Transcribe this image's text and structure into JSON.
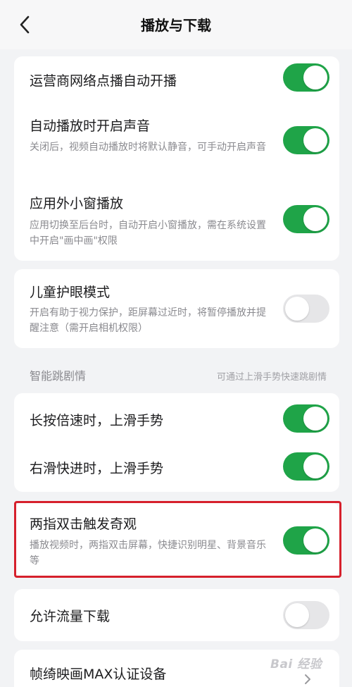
{
  "header": {
    "title": "播放与下载",
    "back_icon": "chevron-left-icon"
  },
  "group1": [
    {
      "title": "运营商网络点播自动开播",
      "desc": "",
      "toggle": "on"
    },
    {
      "title": "自动播放时开启声音",
      "desc": "关闭后，视频自动播放时将默认静音，可手动开启声音",
      "toggle": "on"
    },
    {
      "title": "应用外小窗播放",
      "desc": "应用切换至后台时，自动开启小窗播放，需在系统设置中开启\"画中画\"权限",
      "toggle": "on"
    }
  ],
  "group2": [
    {
      "title": "儿童护眼模式",
      "desc": "开启有助于视力保护，距屏幕过近时，将暂停播放并提醒注意（需开启相机权限）",
      "toggle": "off"
    }
  ],
  "section": {
    "label": "智能跳剧情",
    "hint": "可通过上滑手势快速跳剧情"
  },
  "group3": [
    {
      "title": "长按倍速时，上滑手势",
      "desc": "",
      "toggle": "on"
    },
    {
      "title": "右滑快进时，上滑手势",
      "desc": "",
      "toggle": "on"
    }
  ],
  "group4": [
    {
      "title": "两指双击触发奇观",
      "desc": "播放视频时，两指双击屏幕，快捷识别明星、背景音乐等",
      "toggle": "on"
    }
  ],
  "group5": [
    {
      "title": "允许流量下载",
      "desc": "",
      "toggle": "off"
    }
  ],
  "group6": [
    {
      "title": "帧绮映画MAX认证设备",
      "chevron_icon": "chevron-right-icon"
    }
  ],
  "watermark": "Bai 经验",
  "colors": {
    "toggle_on": "#1fa448",
    "toggle_off": "#e6e6e8",
    "highlight_border": "#d6202c",
    "background": "#f2f3f5"
  }
}
